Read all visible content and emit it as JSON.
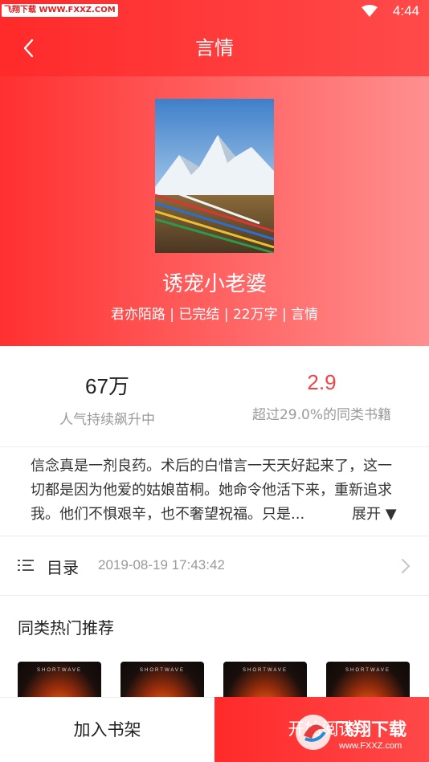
{
  "status_bar": {
    "time": "4:44",
    "watermark": "飞翔下载 WWW.FXXZ.COM"
  },
  "header": {
    "title": "言情",
    "back_icon": "chevron-left-icon"
  },
  "book": {
    "name": "诱宠小老婆",
    "meta": "君亦陌路 | 已完结 | 22万字 | 言情"
  },
  "stats": {
    "popularity_value": "67万",
    "popularity_label": "人气持续飙升中",
    "score_value": "2.9",
    "score_label": "超过29.0%的同类书籍"
  },
  "synopsis": {
    "text": "信念真是一剂良药。术后的白惜言一天天好起来了，这一切都是因为他爱的姑娘苗桐。她命令他活下来，重新追求我。他们不惧艰辛，也不奢望祝福。只是...",
    "expand_label": "展开 ▼"
  },
  "catalog": {
    "label": "目录",
    "updated": "2019-08-19 17:43:42"
  },
  "recommend": {
    "title": "同类热门推荐",
    "cards": [
      {
        "cover_text": "SHORTWAVE"
      },
      {
        "cover_text": "SHORTWAVE"
      },
      {
        "cover_text": "SHORTWAVE"
      },
      {
        "cover_text": "SHORTWAVE"
      }
    ]
  },
  "bottom": {
    "add_shelf": "加入书架",
    "start_read": "开始阅读",
    "logo_watermark": "飞翔下载 www.FXXZ.com"
  },
  "colors": {
    "accent": "#ff2a2a",
    "score": "#f24444",
    "muted": "#9a9a9a"
  }
}
